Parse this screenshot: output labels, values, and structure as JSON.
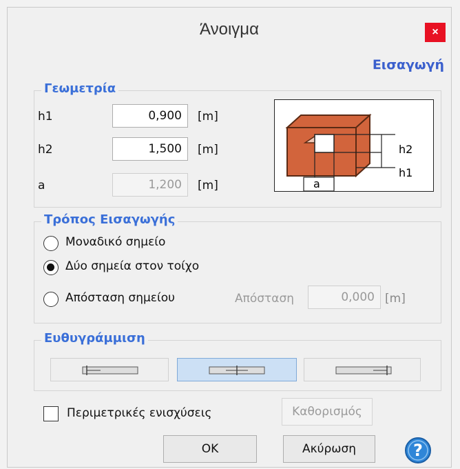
{
  "window": {
    "title": "Άνοιγμα",
    "close_label": "×"
  },
  "header": {
    "subtitle": "Εισαγωγή"
  },
  "geometry": {
    "title": "Γεωμετρία",
    "rows": [
      {
        "label": "h1",
        "value": "0,900",
        "unit": "[m]",
        "enabled": true
      },
      {
        "label": "h2",
        "value": "1,500",
        "unit": "[m]",
        "enabled": true
      },
      {
        "label": "a",
        "value": "1,200",
        "unit": "[m]",
        "enabled": false
      }
    ],
    "diagram_labels": {
      "h2": "h2",
      "h1": "h1",
      "a": "a"
    },
    "colors": {
      "box": "#d2643c",
      "box_edge": "#5a2a14"
    }
  },
  "input_mode": {
    "title": "Τρόπος Εισαγωγής",
    "options": [
      {
        "label": "Μοναδικό σημείο",
        "checked": false
      },
      {
        "label": "Δύο σημεία στον τοίχο",
        "checked": true
      },
      {
        "label": "Απόσταση σημείου",
        "checked": false
      }
    ],
    "distance": {
      "label": "Απόσταση",
      "value": "0,000",
      "unit": "[m]"
    }
  },
  "alignment": {
    "title": "Ευθυγράμμιση",
    "options": [
      "align-left",
      "align-center",
      "align-right"
    ],
    "selected": "align-center"
  },
  "footer": {
    "reinforcement_label": "Περιμετρικές ενισχύσεις",
    "reinforcement_checked": false,
    "define_label": "Καθορισμός",
    "ok_label": "OK",
    "cancel_label": "Ακύρωση"
  }
}
